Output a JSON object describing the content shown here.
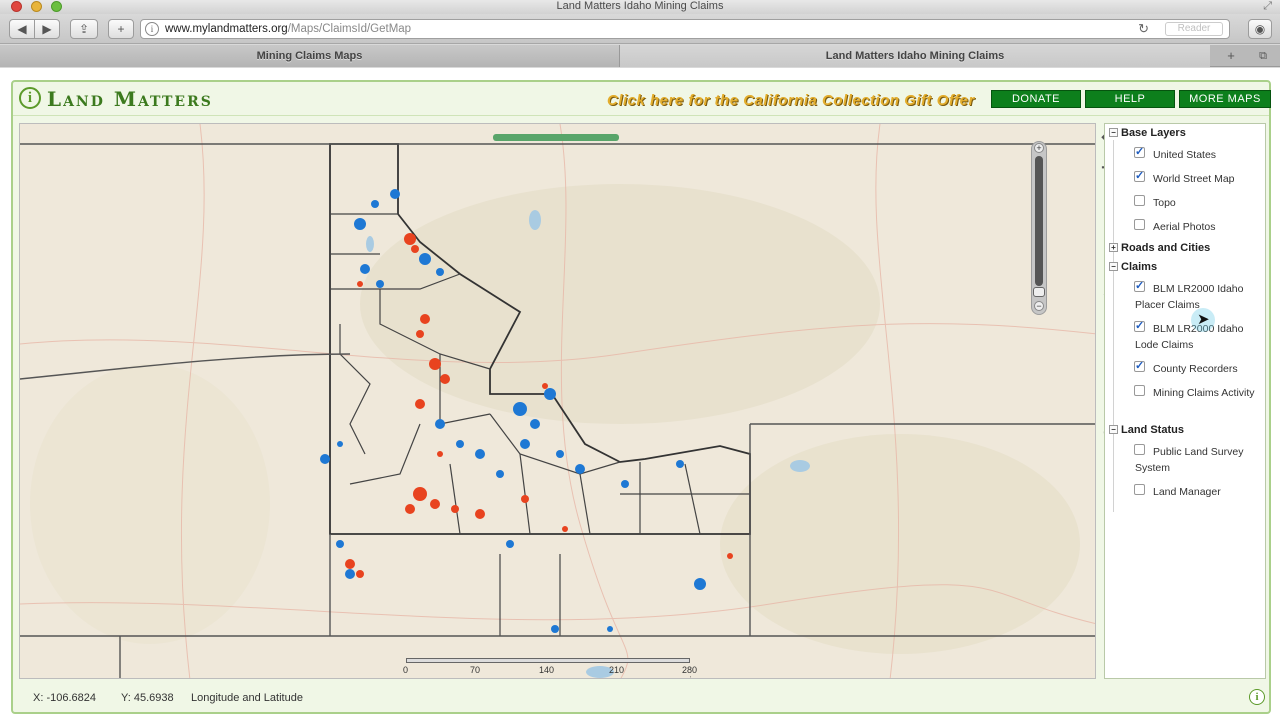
{
  "window": {
    "title": "Land Matters Idaho Mining Claims"
  },
  "toolbar": {
    "url_host": "www.mylandmatters.org",
    "url_path": "/Maps/ClaimsId/GetMap",
    "reader_label": "Reader"
  },
  "tabs": [
    {
      "label": "Mining Claims Maps",
      "active": false
    },
    {
      "label": "Land Matters Idaho Mining Claims",
      "active": true
    }
  ],
  "header": {
    "brand": "Land Matters",
    "promo": "Click here for the California Collection Gift Offer",
    "donate": "DONATE",
    "help": "HELP",
    "more_maps": "MORE MAPS"
  },
  "scale": {
    "labels": [
      "0",
      "70",
      "140",
      "210",
      "280 mi"
    ]
  },
  "layers": {
    "base_layers": {
      "title": "Base Layers",
      "items": [
        {
          "label": "United States",
          "checked": true
        },
        {
          "label": "World Street Map",
          "checked": true
        },
        {
          "label": "Topo",
          "checked": false
        },
        {
          "label": "Aerial Photos",
          "checked": false
        }
      ]
    },
    "roads": {
      "title": "Roads and Cities",
      "collapsed": true
    },
    "claims": {
      "title": "Claims",
      "items": [
        {
          "label": "BLM LR2000 Idaho Placer Claims",
          "checked": true
        },
        {
          "label": "BLM LR2000 Idaho Lode Claims",
          "checked": true
        },
        {
          "label": "County Recorders",
          "checked": true
        },
        {
          "label": "Mining Claims Activity",
          "checked": false
        }
      ]
    },
    "land_status": {
      "title": "Land Status",
      "items": [
        {
          "label": "Public Land Survey System",
          "checked": false
        },
        {
          "label": "Land Manager",
          "checked": false
        }
      ]
    }
  },
  "status": {
    "x": "X:  -106.6824",
    "y": "Y:  45.6938",
    "units": "Longitude and Latitude"
  },
  "colors": {
    "brand_green": "#3c7a1e",
    "button_green": "#0d7f1c",
    "promo_gold": "#e3ad2c",
    "placer_claims": "#e8431f",
    "lode_claims": "#1e78d4"
  }
}
